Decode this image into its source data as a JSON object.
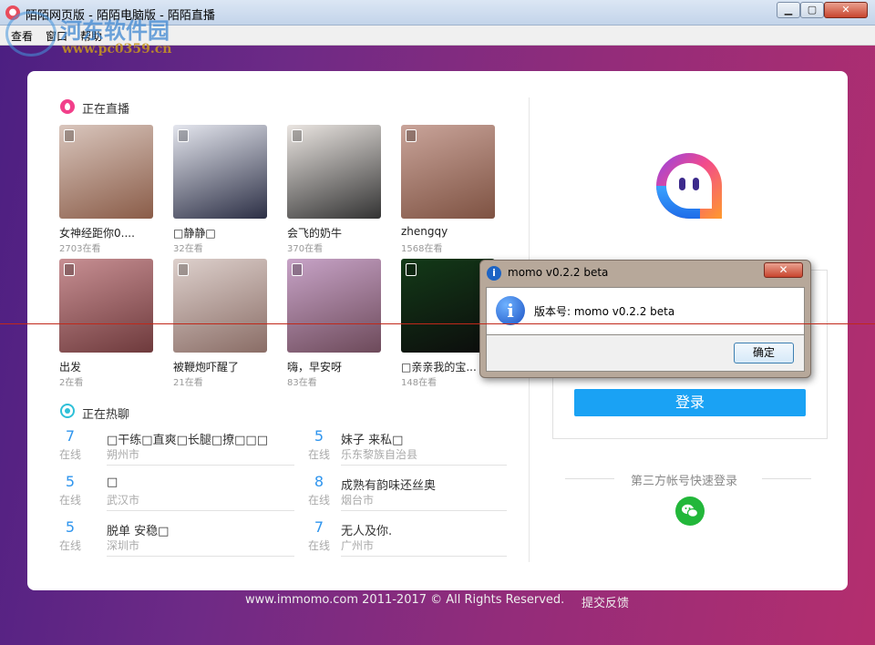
{
  "window": {
    "title": "陌陌网页版 - 陌陌电脑版 - 陌陌直播",
    "minimize_glyph": "▁",
    "maximize_glyph": "▢",
    "close_glyph": "✕"
  },
  "menu": [
    "查看",
    "窗口",
    "帮助"
  ],
  "watermark": {
    "name": "河东软件园",
    "url": "www.pc0359.cn"
  },
  "live": {
    "heading": "正在直播",
    "cards": [
      {
        "name": "女神经距你0....",
        "viewers": "2703在看",
        "colors": [
          "#d9c6bd",
          "#8a5c48"
        ]
      },
      {
        "name": "□静静□",
        "viewers": "32在看",
        "colors": [
          "#e4e6ee",
          "#2c2f45"
        ]
      },
      {
        "name": "会飞的奶牛",
        "viewers": "370在看",
        "colors": [
          "#eae5e1",
          "#333333"
        ]
      },
      {
        "name": "zhengqy",
        "viewers": "1568在看",
        "colors": [
          "#c9a49a",
          "#7e5242"
        ]
      },
      {
        "name": "出发",
        "viewers": "2在看",
        "colors": [
          "#c78f93",
          "#6e3a3c"
        ]
      },
      {
        "name": "被鞭炮吓醒了",
        "viewers": "21在看",
        "colors": [
          "#ddd0cc",
          "#8a6d66"
        ]
      },
      {
        "name": "嗨，早安呀",
        "viewers": "83在看",
        "colors": [
          "#c7a3c7",
          "#6d4a5a"
        ]
      },
      {
        "name": "□亲亲我的宝...",
        "viewers": "148在看",
        "colors": [
          "#133a18",
          "#0c0c0c"
        ]
      }
    ]
  },
  "hot": {
    "heading": "正在热聊",
    "status_label": "在线",
    "items": [
      {
        "count": "7",
        "title": "□干练□直爽□长腿□撩□□□",
        "location": "朔州市"
      },
      {
        "count": "5",
        "title": "妹子 来私□",
        "location": "乐东黎族自治县"
      },
      {
        "count": "5",
        "title": "□",
        "location": "武汉市"
      },
      {
        "count": "8",
        "title": "成熟有韵味还丝奥",
        "location": "烟台市"
      },
      {
        "count": "5",
        "title": "脱单 安稳□",
        "location": "深圳市"
      },
      {
        "count": "7",
        "title": "无人及你.",
        "location": "广州市"
      }
    ]
  },
  "login": {
    "button": "登录",
    "third_party": "第三方帐号快速登录",
    "wechat_icon": "wechat-icon"
  },
  "footer": {
    "copyright": "www.immomo.com 2011-2017 © All Rights Reserved.",
    "feedback": "提交反馈"
  },
  "dialog": {
    "title": "momo v0.2.2 beta",
    "message": "版本号: momo v0.2.2 beta",
    "ok": "确定",
    "close_glyph": "✕",
    "title_icon_glyph": "i",
    "info_glyph": "i"
  },
  "colors": {
    "accent_blue": "#1aa2f4",
    "live_pink": "#f23f8a",
    "wechat_green": "#22b73a",
    "number_blue": "#2f95ee"
  }
}
